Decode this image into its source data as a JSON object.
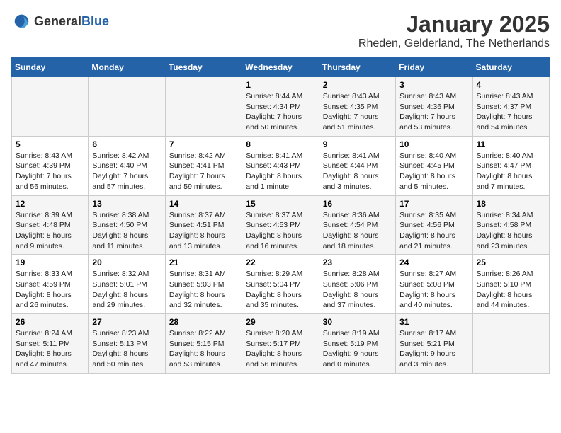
{
  "logo": {
    "general": "General",
    "blue": "Blue"
  },
  "header": {
    "title": "January 2025",
    "subtitle": "Rheden, Gelderland, The Netherlands"
  },
  "weekdays": [
    "Sunday",
    "Monday",
    "Tuesday",
    "Wednesday",
    "Thursday",
    "Friday",
    "Saturday"
  ],
  "weeks": [
    [
      {
        "day": "",
        "info": ""
      },
      {
        "day": "",
        "info": ""
      },
      {
        "day": "",
        "info": ""
      },
      {
        "day": "1",
        "info": "Sunrise: 8:44 AM\nSunset: 4:34 PM\nDaylight: 7 hours\nand 50 minutes."
      },
      {
        "day": "2",
        "info": "Sunrise: 8:43 AM\nSunset: 4:35 PM\nDaylight: 7 hours\nand 51 minutes."
      },
      {
        "day": "3",
        "info": "Sunrise: 8:43 AM\nSunset: 4:36 PM\nDaylight: 7 hours\nand 53 minutes."
      },
      {
        "day": "4",
        "info": "Sunrise: 8:43 AM\nSunset: 4:37 PM\nDaylight: 7 hours\nand 54 minutes."
      }
    ],
    [
      {
        "day": "5",
        "info": "Sunrise: 8:43 AM\nSunset: 4:39 PM\nDaylight: 7 hours\nand 56 minutes."
      },
      {
        "day": "6",
        "info": "Sunrise: 8:42 AM\nSunset: 4:40 PM\nDaylight: 7 hours\nand 57 minutes."
      },
      {
        "day": "7",
        "info": "Sunrise: 8:42 AM\nSunset: 4:41 PM\nDaylight: 7 hours\nand 59 minutes."
      },
      {
        "day": "8",
        "info": "Sunrise: 8:41 AM\nSunset: 4:43 PM\nDaylight: 8 hours\nand 1 minute."
      },
      {
        "day": "9",
        "info": "Sunrise: 8:41 AM\nSunset: 4:44 PM\nDaylight: 8 hours\nand 3 minutes."
      },
      {
        "day": "10",
        "info": "Sunrise: 8:40 AM\nSunset: 4:45 PM\nDaylight: 8 hours\nand 5 minutes."
      },
      {
        "day": "11",
        "info": "Sunrise: 8:40 AM\nSunset: 4:47 PM\nDaylight: 8 hours\nand 7 minutes."
      }
    ],
    [
      {
        "day": "12",
        "info": "Sunrise: 8:39 AM\nSunset: 4:48 PM\nDaylight: 8 hours\nand 9 minutes."
      },
      {
        "day": "13",
        "info": "Sunrise: 8:38 AM\nSunset: 4:50 PM\nDaylight: 8 hours\nand 11 minutes."
      },
      {
        "day": "14",
        "info": "Sunrise: 8:37 AM\nSunset: 4:51 PM\nDaylight: 8 hours\nand 13 minutes."
      },
      {
        "day": "15",
        "info": "Sunrise: 8:37 AM\nSunset: 4:53 PM\nDaylight: 8 hours\nand 16 minutes."
      },
      {
        "day": "16",
        "info": "Sunrise: 8:36 AM\nSunset: 4:54 PM\nDaylight: 8 hours\nand 18 minutes."
      },
      {
        "day": "17",
        "info": "Sunrise: 8:35 AM\nSunset: 4:56 PM\nDaylight: 8 hours\nand 21 minutes."
      },
      {
        "day": "18",
        "info": "Sunrise: 8:34 AM\nSunset: 4:58 PM\nDaylight: 8 hours\nand 23 minutes."
      }
    ],
    [
      {
        "day": "19",
        "info": "Sunrise: 8:33 AM\nSunset: 4:59 PM\nDaylight: 8 hours\nand 26 minutes."
      },
      {
        "day": "20",
        "info": "Sunrise: 8:32 AM\nSunset: 5:01 PM\nDaylight: 8 hours\nand 29 minutes."
      },
      {
        "day": "21",
        "info": "Sunrise: 8:31 AM\nSunset: 5:03 PM\nDaylight: 8 hours\nand 32 minutes."
      },
      {
        "day": "22",
        "info": "Sunrise: 8:29 AM\nSunset: 5:04 PM\nDaylight: 8 hours\nand 35 minutes."
      },
      {
        "day": "23",
        "info": "Sunrise: 8:28 AM\nSunset: 5:06 PM\nDaylight: 8 hours\nand 37 minutes."
      },
      {
        "day": "24",
        "info": "Sunrise: 8:27 AM\nSunset: 5:08 PM\nDaylight: 8 hours\nand 40 minutes."
      },
      {
        "day": "25",
        "info": "Sunrise: 8:26 AM\nSunset: 5:10 PM\nDaylight: 8 hours\nand 44 minutes."
      }
    ],
    [
      {
        "day": "26",
        "info": "Sunrise: 8:24 AM\nSunset: 5:11 PM\nDaylight: 8 hours\nand 47 minutes."
      },
      {
        "day": "27",
        "info": "Sunrise: 8:23 AM\nSunset: 5:13 PM\nDaylight: 8 hours\nand 50 minutes."
      },
      {
        "day": "28",
        "info": "Sunrise: 8:22 AM\nSunset: 5:15 PM\nDaylight: 8 hours\nand 53 minutes."
      },
      {
        "day": "29",
        "info": "Sunrise: 8:20 AM\nSunset: 5:17 PM\nDaylight: 8 hours\nand 56 minutes."
      },
      {
        "day": "30",
        "info": "Sunrise: 8:19 AM\nSunset: 5:19 PM\nDaylight: 9 hours\nand 0 minutes."
      },
      {
        "day": "31",
        "info": "Sunrise: 8:17 AM\nSunset: 5:21 PM\nDaylight: 9 hours\nand 3 minutes."
      },
      {
        "day": "",
        "info": ""
      }
    ]
  ]
}
